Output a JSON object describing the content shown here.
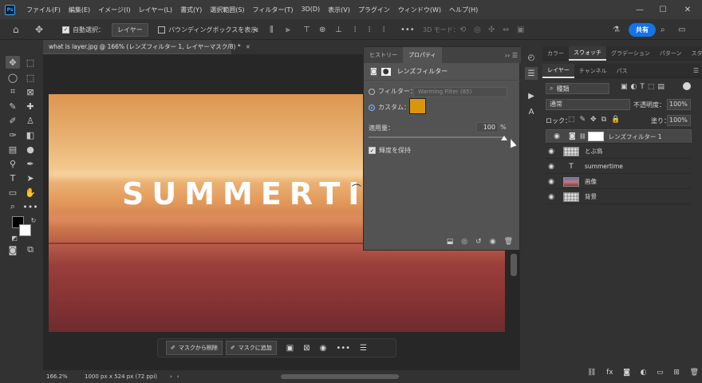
{
  "menubar": {
    "logo": "Ps",
    "items": [
      "ファイル(F)",
      "編集(E)",
      "イメージ(I)",
      "レイヤー(L)",
      "書式(Y)",
      "選択範囲(S)",
      "フィルター(T)",
      "3D(D)",
      "表示(V)",
      "プラグイン",
      "ウィンドウ(W)",
      "ヘルプ(H)"
    ],
    "minimize": "—",
    "restore": "☐",
    "close": "✕"
  },
  "options": {
    "auto_select_label": "自動選択：",
    "auto_select_target": "レイヤー",
    "bounding_box_label": "バウンディングボックスを表示",
    "mode_3d_label": "3D モード：",
    "share_label": "共有"
  },
  "document": {
    "tab_title": "what is layer.jpg @ 166% (レンズフィルター 1, レイヤーマスク/8) *",
    "close": "×",
    "image_text": "SUMMERTI",
    "zoom": "166.2%",
    "info": "1000 px x 524 px (72 ppi)"
  },
  "context_bar": {
    "remove_label": "マスクから削除",
    "add_label": "マスクに追加"
  },
  "properties": {
    "tabs": [
      "ヒストリー",
      "プロパティ"
    ],
    "heading": "レンズフィルター",
    "filter_label": "フィルター：",
    "filter_value": "Warming Filter (85)",
    "custom_label": "カスタム：",
    "custom_color": "#d9960a",
    "density_label": "適用量：",
    "density_value": "100",
    "density_unit": "%",
    "preserve_label": "輝度を保持",
    "density_fraction": 1.0
  },
  "right_panel": {
    "top_tabs": [
      "カラー",
      "スウォッチ",
      "グラデーション",
      "パターン",
      "スタイル"
    ],
    "layer_tabs": [
      "レイヤー",
      "チャンネル",
      "パス"
    ],
    "kind_label": "種類",
    "blend_mode": "通常",
    "opacity_label": "不透明度：",
    "opacity_value": "100%",
    "lock_label": "ロック：",
    "fill_label": "塗り：",
    "fill_value": "100%",
    "layers": [
      {
        "name": "レンズフィルター 1",
        "selected": true
      },
      {
        "name": "とぶ鳥",
        "selected": false
      },
      {
        "name": "summertime",
        "selected": false
      },
      {
        "name": "画像",
        "selected": false
      },
      {
        "name": "背景",
        "selected": false
      }
    ],
    "type_glyph": "T"
  }
}
